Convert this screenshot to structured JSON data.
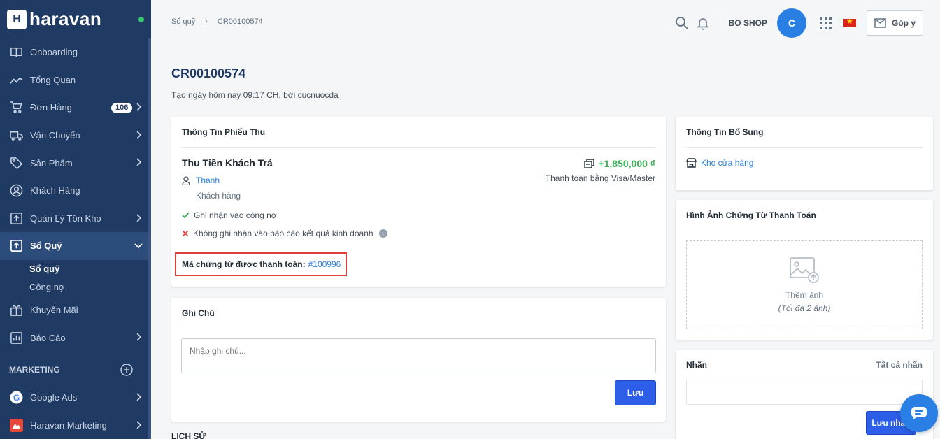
{
  "brand": {
    "name": "haravan",
    "logo_letter": "H",
    "status": "online"
  },
  "sidebar": {
    "items": [
      {
        "label": "Onboarding",
        "icon": "book-icon",
        "has_children": false
      },
      {
        "label": "Tổng Quan",
        "icon": "trend-icon",
        "has_children": false
      },
      {
        "label": "Đơn Hàng",
        "icon": "cart-icon",
        "has_children": true,
        "badge": "106"
      },
      {
        "label": "Vận Chuyển",
        "icon": "truck-icon",
        "has_children": true
      },
      {
        "label": "Sản Phẩm",
        "icon": "tag-icon",
        "has_children": true
      },
      {
        "label": "Khách Hàng",
        "icon": "user-circle-icon",
        "has_children": false
      },
      {
        "label": "Quản Lý Tồn Kho",
        "icon": "inventory-icon",
        "has_children": true
      },
      {
        "label": "Sổ Quỹ",
        "icon": "cashbook-icon",
        "has_children": true,
        "active": true
      }
    ],
    "sub_items": [
      {
        "label": "Sổ quỹ",
        "active": true
      },
      {
        "label": "Công nợ",
        "active": false
      }
    ],
    "items_after": [
      {
        "label": "Khuyến Mãi",
        "icon": "gift-icon",
        "has_children": false
      },
      {
        "label": "Báo Cáo",
        "icon": "chart-icon",
        "has_children": true
      }
    ],
    "marketing_label": "MARKETING",
    "marketing_items": [
      {
        "label": "Google Ads",
        "icon": "google-icon",
        "has_children": true
      },
      {
        "label": "Haravan Marketing",
        "icon": "haravan-marketing-icon",
        "has_children": true
      }
    ]
  },
  "topbar": {
    "breadcrumb": [
      "Sổ quỹ",
      "CR00100574"
    ],
    "shop_name": "BO SHOP",
    "avatar_letter": "C",
    "feedback_label": "Góp ý"
  },
  "page": {
    "title": "CR00100574",
    "subtitle": "Tạo ngày hôm nay 09:17 CH, bởi cucnuocda"
  },
  "receipt_card": {
    "title": "Thông Tin Phiếu Thu",
    "type": "Thu Tiền Khách Trả",
    "amount": "+1,850,000 ₫",
    "payment_method": "Thanh toán bằng Visa/Master",
    "customer_name": "Thanh",
    "customer_role": "Khách hàng",
    "check_1": "Ghi nhận vào công nợ",
    "check_2": "Không ghi nhận vào báo cáo kết quả kinh doanh",
    "doc_ref_label": "Mã chứng từ được thanh toán:",
    "doc_ref_value": "#100996"
  },
  "note_card": {
    "title": "Ghi Chú",
    "placeholder": "Nhập ghi chú...",
    "save_label": "Lưu"
  },
  "extra_card": {
    "title": "Thông Tin Bổ Sung",
    "store": "Kho cửa hàng"
  },
  "image_card": {
    "title": "Hình Ảnh Chứng Từ Thanh Toán",
    "add_label": "Thêm ảnh",
    "hint": "(Tối đa 2 ảnh)"
  },
  "tags_card": {
    "title": "Nhãn",
    "all_label": "Tất cả nhãn",
    "save_label": "Lưu nhãn"
  },
  "history_label": "LỊCH SỬ",
  "colors": {
    "sidebar_bg": "#1f3a63",
    "primary": "#2c5ee8",
    "amount_green": "#35b055",
    "highlight_red": "#e0403a"
  }
}
